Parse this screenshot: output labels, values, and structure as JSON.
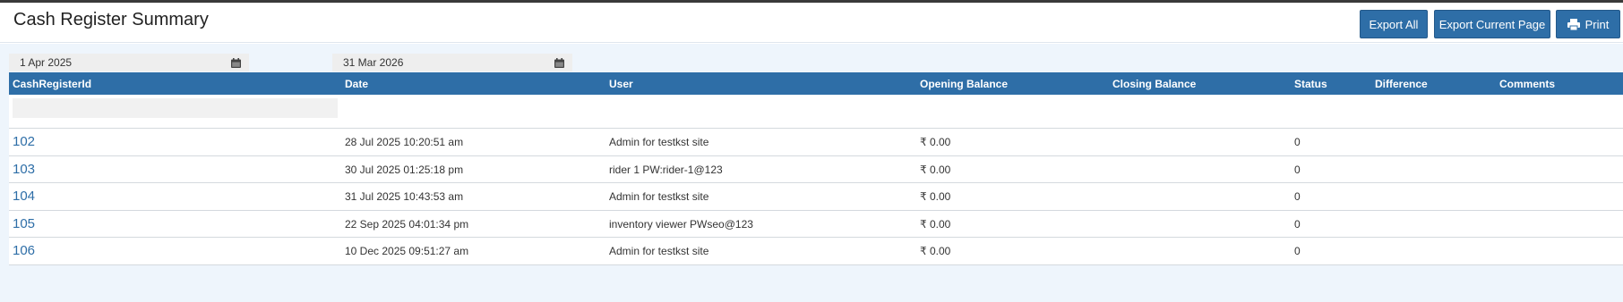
{
  "page": {
    "title": "Cash Register Summary"
  },
  "toolbar": {
    "export_all_label": "Export All",
    "export_current_label": "Export Current Page",
    "print_label": "Print"
  },
  "filters": {
    "from_date": "1 Apr 2025",
    "to_date": "31 Mar 2026"
  },
  "grid": {
    "columns": [
      "CashRegisterId",
      "Date",
      "User",
      "Opening Balance",
      "Closing Balance",
      "Status",
      "Difference",
      "Comments"
    ],
    "rows": [
      {
        "id": "102",
        "date": "28 Jul 2025 10:20:51 am",
        "user": "Admin for testkst site",
        "opening_balance": "₹ 0.00",
        "closing_balance": "",
        "status": "0",
        "difference": "",
        "comments": ""
      },
      {
        "id": "103",
        "date": "30 Jul 2025 01:25:18 pm",
        "user": "rider 1 PW:rider-1@123",
        "opening_balance": "₹ 0.00",
        "closing_balance": "",
        "status": "0",
        "difference": "",
        "comments": ""
      },
      {
        "id": "104",
        "date": "31 Jul 2025 10:43:53 am",
        "user": "Admin for testkst site",
        "opening_balance": "₹ 0.00",
        "closing_balance": "",
        "status": "0",
        "difference": "",
        "comments": ""
      },
      {
        "id": "105",
        "date": "22 Sep 2025 04:01:34 pm",
        "user": "inventory viewer PWseo@123",
        "opening_balance": "₹ 0.00",
        "closing_balance": "",
        "status": "0",
        "difference": "",
        "comments": ""
      },
      {
        "id": "106",
        "date": "10 Dec 2025 09:51:27 am",
        "user": "Admin for testkst site",
        "opening_balance": "₹ 0.00",
        "closing_balance": "",
        "status": "0",
        "difference": "",
        "comments": ""
      }
    ]
  },
  "icons": {
    "calendar": "calendar-icon",
    "print": "printer-icon"
  },
  "colors": {
    "accent": "#2e6ea7",
    "content_bg": "#eef5fc",
    "link": "#2e6ea7"
  }
}
